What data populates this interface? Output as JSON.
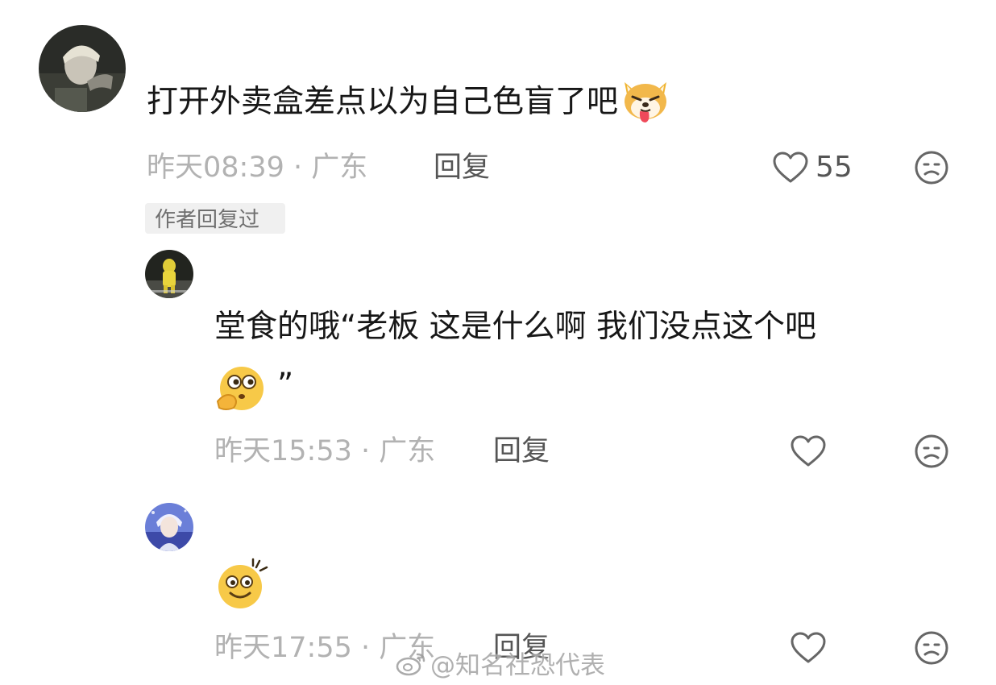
{
  "comments": [
    {
      "text": "打开外卖盒差点以为自己色盲了吧",
      "emoji": "shiba-dog-emoji",
      "meta": "昨天08:39 · 广东",
      "reply_label": "回复",
      "like_count": "55",
      "author_tag": "作者回复过"
    },
    {
      "text_line1": "堂食的哦“老板 这是什么啊 我们没点这个吧",
      "emoji": "thinking-face-emoji",
      "text_line2_suffix": "”",
      "meta": "昨天15:53 · 广东",
      "reply_label": "回复"
    },
    {
      "emoji": "dizzy-smile-emoji",
      "meta": "昨天17:55 · 广东",
      "reply_label": "回复"
    }
  ],
  "watermark": {
    "text": "@知名社恐代表"
  },
  "icons": {
    "like": "heart-outline-icon",
    "dislike": "sad-face-icon"
  },
  "colors": {
    "text": "#171717",
    "meta": "#b2b2b2",
    "reply": "#555555",
    "tag_bg": "#f0f0f0"
  }
}
